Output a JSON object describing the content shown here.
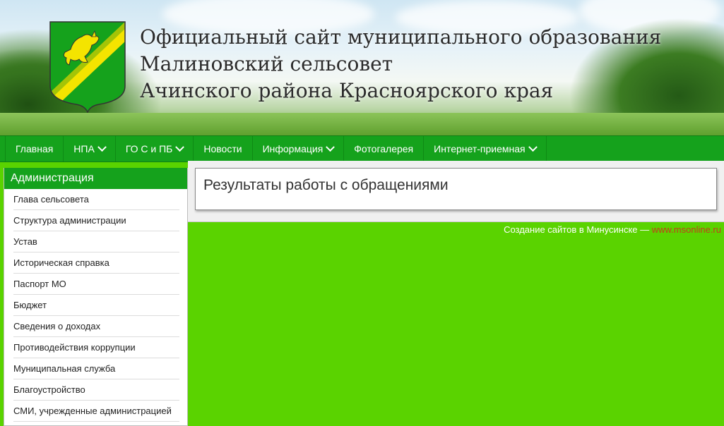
{
  "header": {
    "title_lines": [
      "Официальный сайт муниципального образования",
      "Малиновский сельсовет",
      "Ачинского района Красноярского края"
    ]
  },
  "nav": {
    "items": [
      {
        "label": "Главная",
        "dropdown": false
      },
      {
        "label": "НПА",
        "dropdown": true
      },
      {
        "label": "ГО С и ПБ",
        "dropdown": true
      },
      {
        "label": "Новости",
        "dropdown": false
      },
      {
        "label": "Информация",
        "dropdown": true
      },
      {
        "label": "Фотогалерея",
        "dropdown": false
      },
      {
        "label": "Интернет-приемная",
        "dropdown": true
      }
    ]
  },
  "sidebar": {
    "title": "Администрация",
    "items": [
      "Глава сельсовета",
      "Структура администрации",
      "Устав",
      "Историческая справка",
      "Паспорт МО",
      "Бюджет",
      "Сведения о доходах",
      "Противодействия коррупции",
      "Муниципальная служба",
      "Благоустройство",
      "СМИ, учрежденные администрацией"
    ]
  },
  "main": {
    "page_title": "Результаты работы с обращениями"
  },
  "footer": {
    "credit_text": "Создание сайтов в Минусинске — ",
    "credit_link": "www.msonline.ru"
  },
  "colors": {
    "nav_green": "#15a21c",
    "page_bg": "#5ad300",
    "link_red": "#c43c1c"
  }
}
